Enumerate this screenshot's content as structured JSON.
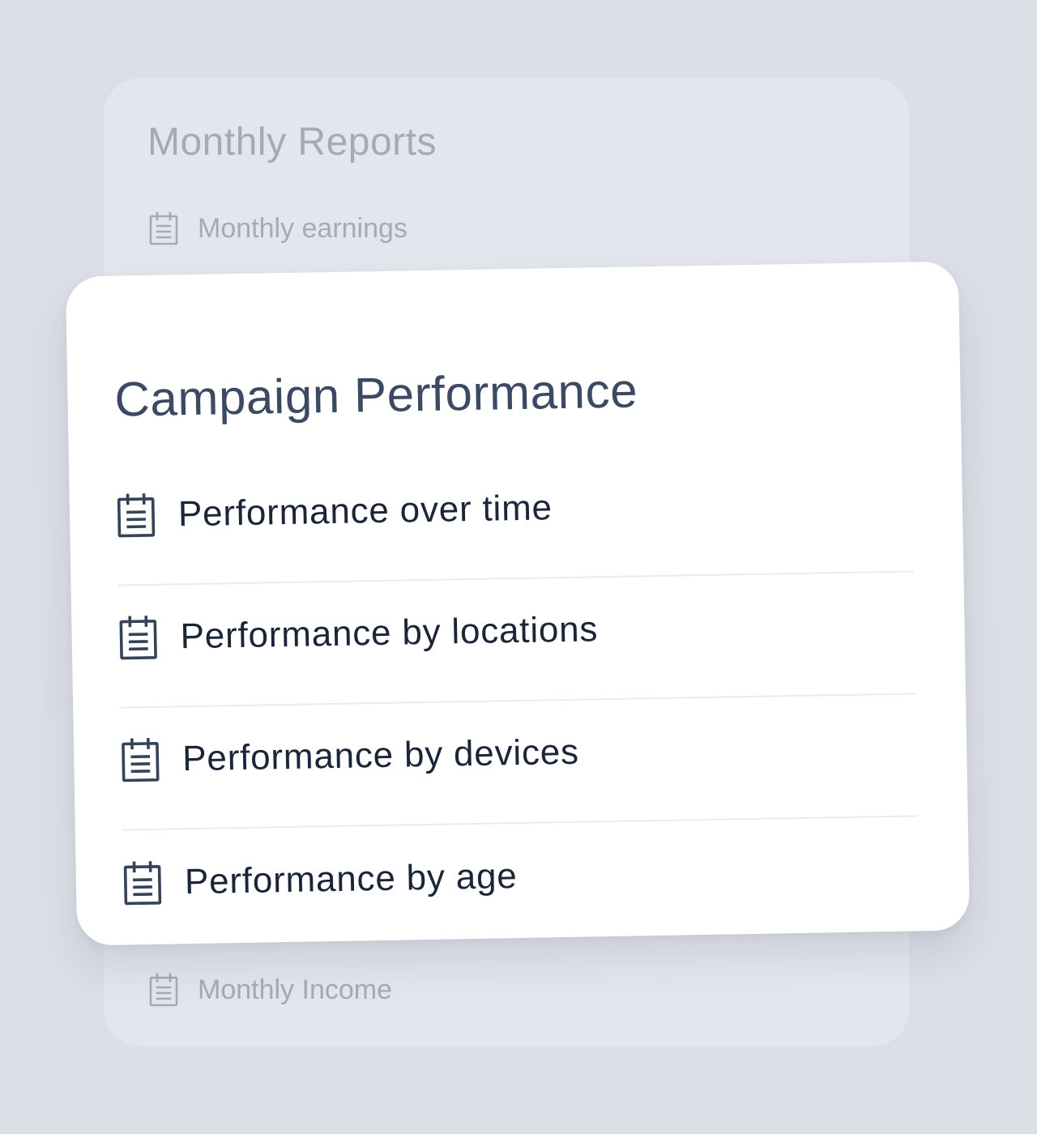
{
  "background_card": {
    "title": "Monthly Reports",
    "items": [
      {
        "label": "Monthly earnings",
        "icon": "report-icon"
      },
      {
        "label": "Monthly Income",
        "icon": "report-icon"
      }
    ]
  },
  "foreground_card": {
    "title": "Campaign Performance",
    "items": [
      {
        "label": "Performance over time",
        "icon": "report-icon"
      },
      {
        "label": "Performance by locations",
        "icon": "report-icon"
      },
      {
        "label": "Performance by devices",
        "icon": "report-icon"
      },
      {
        "label": "Performance by age",
        "icon": "report-icon"
      }
    ]
  },
  "colors": {
    "page_background": "#dcdfe6",
    "muted_card": "#e4e6ed",
    "muted_text": "#a4abb6",
    "card": "#ffffff",
    "title_text": "#3b4a62",
    "item_text": "#1b2538",
    "icon_stroke": "#34425a",
    "divider": "#e8ebef"
  }
}
